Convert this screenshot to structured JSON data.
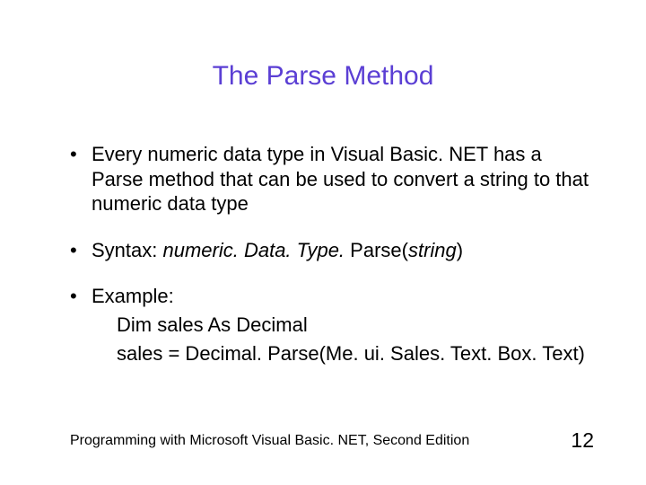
{
  "title": "The Parse Method",
  "bullets": {
    "b1": "Every numeric data type in Visual Basic. NET has a Parse method that can be used to convert a string to that numeric data type",
    "b2_prefix": "Syntax: ",
    "b2_syntax": "numeric. Data. Type.",
    "b2_middle": " Parse(",
    "b2_arg": "string",
    "b2_close": ")",
    "b3": "Example:",
    "b3_sub1": "Dim sales As Decimal",
    "b3_sub2": "sales = Decimal. Parse(Me. ui. Sales. Text. Box. Text)"
  },
  "footer": "Programming with Microsoft Visual Basic. NET, Second Edition",
  "page": "12"
}
